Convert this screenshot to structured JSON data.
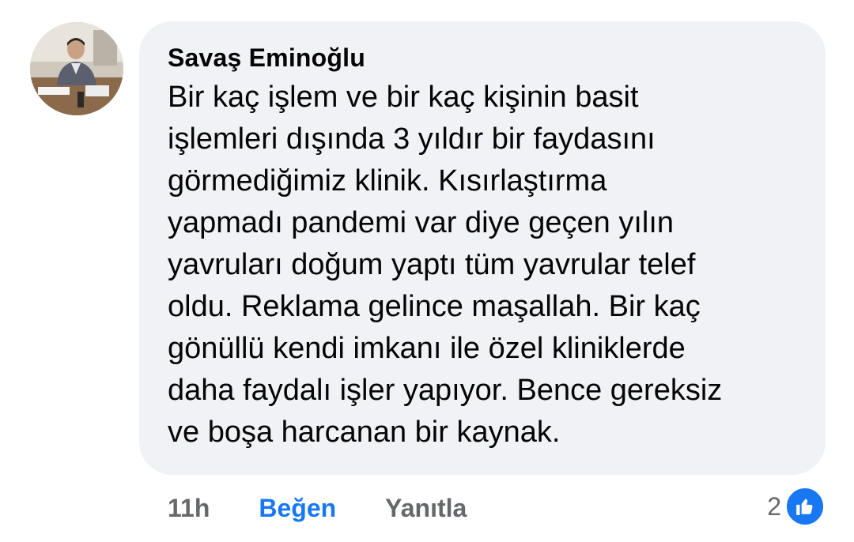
{
  "comment": {
    "author": "Savaş Eminoğlu",
    "text": "Bir kaç işlem ve bir kaç kişinin basit\nişlemleri dışında 3 yıldır bir faydasını\ngörmediğimiz klinik. Kısırlaştırma\nyapmadı pandemi var diye geçen yılın\nyavruları doğum yaptı tüm yavrular telef\noldu. Reklama gelince maşallah. Bir kaç\ngönüllü kendi imkanı ile özel kliniklerde\ndaha faydalı işler yapıyor. Bence gereksiz\nve boşa harcanan bir kaynak."
  },
  "actions": {
    "time": "11h",
    "like_label": "Beğen",
    "reply_label": "Yanıtla"
  },
  "reactions": {
    "count": "2",
    "icon": "thumbs-up-icon",
    "icon_color": "#1877f2"
  },
  "colors": {
    "bubble": "#f0f2f5",
    "accent": "#1877f2",
    "muted": "#65676b"
  }
}
